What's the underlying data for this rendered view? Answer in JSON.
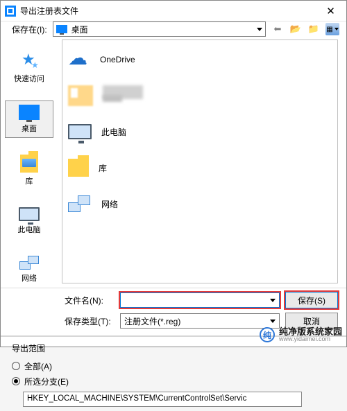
{
  "titlebar": {
    "title": "导出注册表文件"
  },
  "location": {
    "label": "保存在(I):",
    "selected": "桌面"
  },
  "places": {
    "quick": "快速访问",
    "desktop": "桌面",
    "library": "库",
    "thispc": "此电脑",
    "network": "网络"
  },
  "filelist": {
    "onedrive": "OneDrive",
    "unknown_folder": "",
    "thispc": "此电脑",
    "library": "库",
    "network": "网络"
  },
  "filename": {
    "label": "文件名(N):",
    "value": ""
  },
  "filetype": {
    "label": "保存类型(T):",
    "value": "注册文件(*.reg)"
  },
  "buttons": {
    "save": "保存(S)",
    "cancel": "取消"
  },
  "scope": {
    "title": "导出范围",
    "all": "全部(A)",
    "branch": "所选分支(E)",
    "path": "HKEY_LOCAL_MACHINE\\SYSTEM\\CurrentControlSet\\Servic"
  },
  "watermark": {
    "brand": "纯净版系统家园",
    "url": "www.yidaimei.com"
  }
}
